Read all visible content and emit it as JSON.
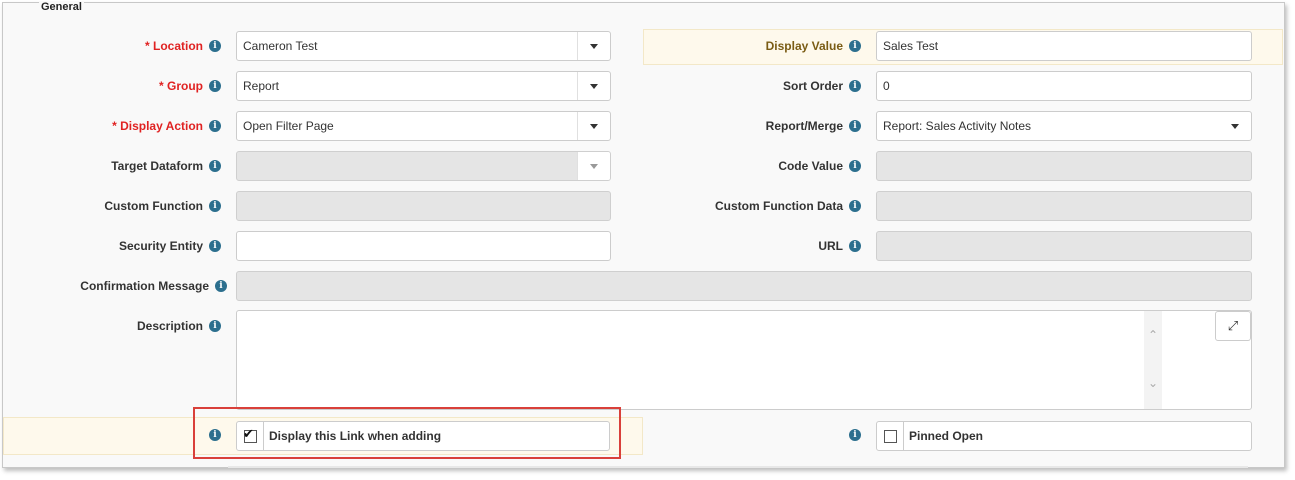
{
  "section": {
    "title": "General"
  },
  "left_fields": [
    {
      "label": "* Location",
      "value": "Cameron Test"
    },
    {
      "label": "* Group",
      "value": "Report"
    },
    {
      "label": "* Display Action",
      "value": "Open Filter Page"
    },
    {
      "label": "Target Dataform",
      "value": ""
    },
    {
      "label": "Custom Function",
      "value": ""
    },
    {
      "label": "Security Entity",
      "value": ""
    }
  ],
  "right_fields": [
    {
      "label": "Display Value",
      "value": "Sales Test"
    },
    {
      "label": "Sort Order",
      "value": "0"
    },
    {
      "label": "Report/Merge",
      "value": "Report: Sales Activity Notes"
    },
    {
      "label": "Code Value",
      "value": ""
    },
    {
      "label": "Custom Function Data",
      "value": ""
    },
    {
      "label": "URL",
      "value": ""
    }
  ],
  "confirmation": {
    "label": "Confirmation Message",
    "value": ""
  },
  "description": {
    "label": "Description",
    "value": ""
  },
  "checkboxes": {
    "display_link": {
      "label": "Display this Link when adding",
      "checked": true
    },
    "pinned_open": {
      "label": "Pinned Open",
      "checked": false
    }
  },
  "icons": {
    "info": "i",
    "check": "✔",
    "expand": "⤢",
    "up": "⌃",
    "down": "⌄"
  },
  "colors": {
    "required": "#e02222",
    "info": "#2c6f8e",
    "highlight": "#fef9ec",
    "annotation": "#d9403a"
  }
}
